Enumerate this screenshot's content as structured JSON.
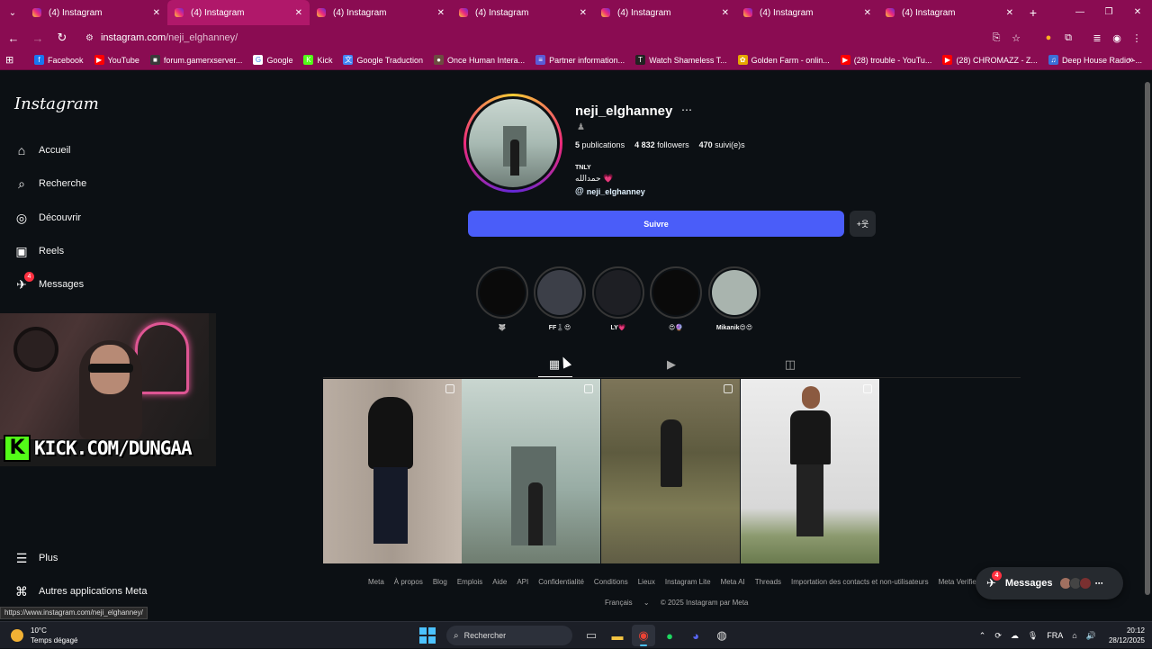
{
  "browser": {
    "tabs": [
      {
        "title": "(4) Instagram",
        "active": false
      },
      {
        "title": "(4) Instagram",
        "active": true
      },
      {
        "title": "(4) Instagram",
        "active": false
      },
      {
        "title": "(4) Instagram",
        "active": false
      },
      {
        "title": "(4) Instagram",
        "active": false
      },
      {
        "title": "(4) Instagram",
        "active": false
      },
      {
        "title": "(4) Instagram",
        "active": false
      }
    ],
    "url_host": "instagram.com",
    "url_path": "/neji_elghanney/",
    "bookmarks": [
      {
        "label": "Facebook",
        "color": "#1877f2",
        "glyph": "f"
      },
      {
        "label": "YouTube",
        "color": "#ff0000",
        "glyph": "▶"
      },
      {
        "label": "forum.gamerxserver...",
        "color": "#3a3a3a",
        "glyph": "■"
      },
      {
        "label": "Google",
        "color": "#ffffff",
        "glyph": "G"
      },
      {
        "label": "Kick",
        "color": "#53fc18",
        "glyph": "K"
      },
      {
        "label": "Google Traduction",
        "color": "#4285f4",
        "glyph": "文"
      },
      {
        "label": "Once Human Intera...",
        "color": "#6d4c41",
        "glyph": "●"
      },
      {
        "label": "Partner information...",
        "color": "#5b5bd6",
        "glyph": "≡"
      },
      {
        "label": "Watch Shameless T...",
        "color": "#222222",
        "glyph": "T"
      },
      {
        "label": "Golden Farm - onlin...",
        "color": "#e6a700",
        "glyph": "✿"
      },
      {
        "label": "(28) trouble - YouTu...",
        "color": "#ff0000",
        "glyph": "▶"
      },
      {
        "label": "(28) CHROMAZZ - Z...",
        "color": "#ff0000",
        "glyph": "▶"
      },
      {
        "label": "Deep House Radio -...",
        "color": "#3b6fd8",
        "glyph": "♫"
      }
    ],
    "status_url": "https://www.instagram.com/neji_elghanney/"
  },
  "sidebar": {
    "logo": "Instagram",
    "items": [
      {
        "label": "Accueil",
        "icon": "⌂"
      },
      {
        "label": "Recherche",
        "icon": "⌕"
      },
      {
        "label": "Découvrir",
        "icon": "◎"
      },
      {
        "label": "Reels",
        "icon": "▣"
      },
      {
        "label": "Messages",
        "icon": "✈",
        "badge": "4"
      }
    ],
    "bottom_items": [
      {
        "label": "Plus",
        "icon": "☰"
      },
      {
        "label": "Autres applications Meta",
        "icon": "⌘"
      }
    ]
  },
  "stream_overlay": {
    "kick_text": "KICK.COM/DUNGAA"
  },
  "profile": {
    "username": "neji_elghanney",
    "sub_icon": "♟",
    "stats": [
      {
        "value": "5",
        "label": "publications"
      },
      {
        "value": "4 832",
        "label": "followers"
      },
      {
        "value": "470",
        "label": "suivi(e)s"
      }
    ],
    "bio_name": "TNLY",
    "bio_line": "حمدالله",
    "bio_heart": "💗",
    "threads_handle": "neji_elghanney",
    "follow_label": "Suivre",
    "suggest_icon": "+웃"
  },
  "highlights": [
    {
      "label": "🐺",
      "color": "#0a0a0a"
    },
    {
      "label": "FF♟️😍",
      "color": "#3c3f48"
    },
    {
      "label": "LY💗",
      "color": "#1e1f24"
    },
    {
      "label": "😍🔮",
      "color": "#0a0a0a"
    },
    {
      "label": "Mikanik😍😍",
      "color": "#a9b4ae"
    }
  ],
  "profile_tabs": [
    {
      "name": "posts",
      "icon": "▦"
    },
    {
      "name": "reels",
      "icon": "▶"
    },
    {
      "name": "tagged",
      "icon": "◫"
    }
  ],
  "footer": {
    "links": [
      "Meta",
      "À propos",
      "Blog",
      "Emplois",
      "Aide",
      "API",
      "Confidentialité",
      "Conditions",
      "Lieux",
      "Instagram Lite",
      "Meta AI",
      "Threads",
      "Importation des contacts et non-utilisateurs",
      "Meta Verified"
    ],
    "language": "Français",
    "copyright": "© 2025 Instagram par Meta"
  },
  "messages_pill": {
    "label": "Messages",
    "badge": "4"
  },
  "taskbar": {
    "temperature": "10°C",
    "weather": "Temps dégagé",
    "search_placeholder": "Rechercher",
    "language": "FRA",
    "time": "20:12",
    "date": "28/12/2025"
  }
}
